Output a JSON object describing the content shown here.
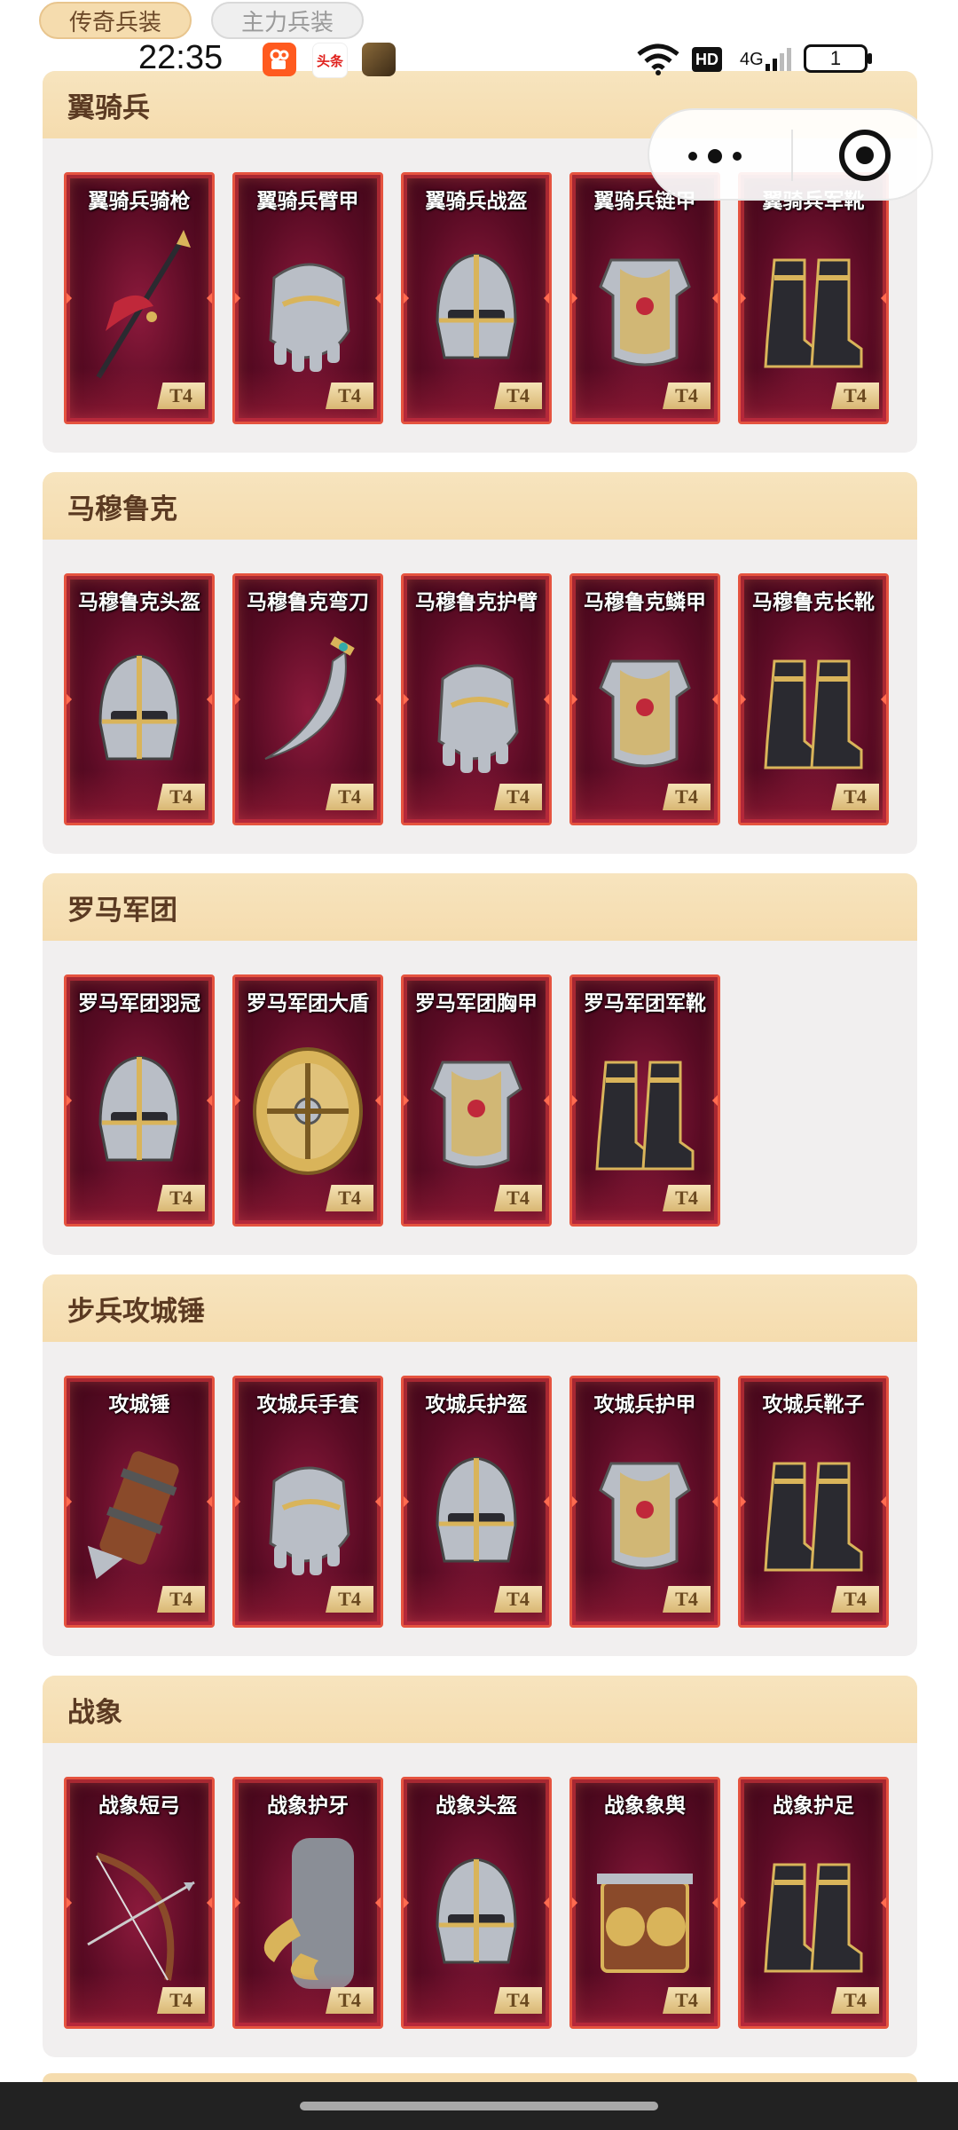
{
  "tabs": [
    {
      "label": "传奇兵装",
      "active": true
    },
    {
      "label": "主力兵装",
      "active": false
    }
  ],
  "status_bar": {
    "time": "22:35",
    "app_icons": [
      "kuaishou-icon",
      "toutiao-icon",
      "game-icon"
    ],
    "toutiao_text": "头条",
    "hd": "HD",
    "signal": "4G",
    "battery": "1"
  },
  "capsule": {
    "more_icon": "more-icon",
    "close_icon": "target-close-icon"
  },
  "sections": [
    {
      "title": "翼骑兵",
      "items": [
        {
          "name": "翼骑兵骑枪",
          "tier": "T4",
          "icon": "lance-icon"
        },
        {
          "name": "翼骑兵臂甲",
          "tier": "T4",
          "icon": "gauntlet-icon"
        },
        {
          "name": "翼骑兵战盔",
          "tier": "T4",
          "icon": "helmet-icon"
        },
        {
          "name": "翼骑兵链甲",
          "tier": "T4",
          "icon": "armor-icon"
        },
        {
          "name": "翼骑兵军靴",
          "tier": "T4",
          "icon": "boots-icon"
        }
      ]
    },
    {
      "title": "马穆鲁克",
      "items": [
        {
          "name": "马穆鲁克头盔",
          "tier": "T4",
          "icon": "helmet-icon"
        },
        {
          "name": "马穆鲁克弯刀",
          "tier": "T4",
          "icon": "scimitar-icon"
        },
        {
          "name": "马穆鲁克护臂",
          "tier": "T4",
          "icon": "gauntlet-icon"
        },
        {
          "name": "马穆鲁克鳞甲",
          "tier": "T4",
          "icon": "armor-icon"
        },
        {
          "name": "马穆鲁克长靴",
          "tier": "T4",
          "icon": "boots-icon"
        }
      ]
    },
    {
      "title": "罗马军团",
      "items": [
        {
          "name": "罗马军团羽冠",
          "tier": "T4",
          "icon": "helmet-icon"
        },
        {
          "name": "罗马军团大盾",
          "tier": "T4",
          "icon": "shield-icon"
        },
        {
          "name": "罗马军团胸甲",
          "tier": "T4",
          "icon": "armor-icon"
        },
        {
          "name": "罗马军团军靴",
          "tier": "T4",
          "icon": "boots-icon"
        }
      ]
    },
    {
      "title": "步兵攻城锤",
      "items": [
        {
          "name": "攻城锤",
          "tier": "T4",
          "icon": "ram-icon"
        },
        {
          "name": "攻城兵手套",
          "tier": "T4",
          "icon": "gauntlet-icon"
        },
        {
          "name": "攻城兵护盔",
          "tier": "T4",
          "icon": "helmet-icon"
        },
        {
          "name": "攻城兵护甲",
          "tier": "T4",
          "icon": "armor-icon"
        },
        {
          "name": "攻城兵靴子",
          "tier": "T4",
          "icon": "boots-icon"
        }
      ]
    },
    {
      "title": "战象",
      "items": [
        {
          "name": "战象短弓",
          "tier": "T4",
          "icon": "bow-icon"
        },
        {
          "name": "战象护牙",
          "tier": "T4",
          "icon": "tusk-icon"
        },
        {
          "name": "战象头盔",
          "tier": "T4",
          "icon": "helmet-icon"
        },
        {
          "name": "战象象舆",
          "tier": "T4",
          "icon": "howdah-icon"
        },
        {
          "name": "战象护足",
          "tier": "T4",
          "icon": "boots-icon"
        }
      ]
    }
  ],
  "colors": {
    "header_bg": "#f5dcae",
    "header_text": "#5b3a22",
    "card_border": "#e5533f",
    "card_bg": "#5a0b24",
    "tier_badge": "#e6c98a"
  }
}
